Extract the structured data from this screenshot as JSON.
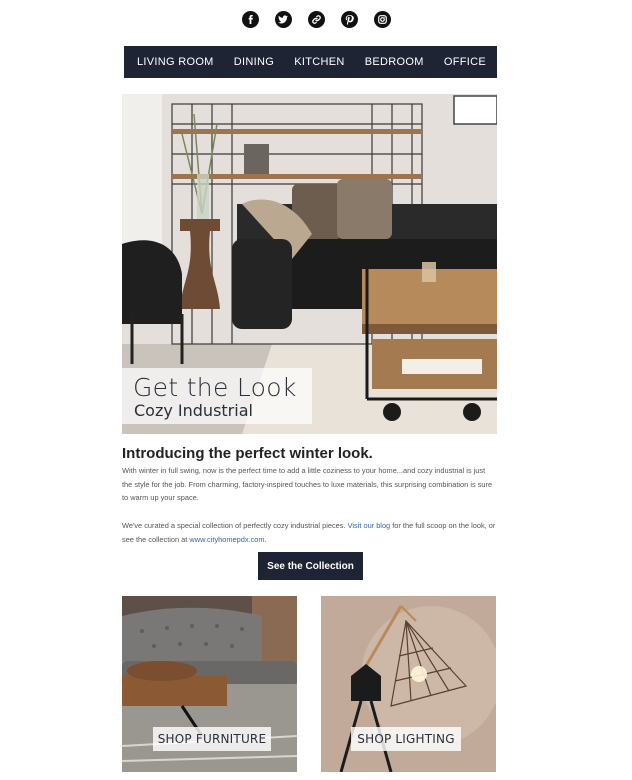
{
  "social": {
    "icons": [
      "facebook-icon",
      "twitter-icon",
      "link-icon",
      "pinterest-icon",
      "instagram-icon"
    ]
  },
  "nav": {
    "items": [
      "LIVING ROOM",
      "DINING",
      "KITCHEN",
      "BEDROOM",
      "OFFICE"
    ]
  },
  "hero": {
    "title": "Get the Look",
    "subtitle": "Cozy Industrial"
  },
  "article": {
    "headline": "Introducing the perfect winter look.",
    "paragraph1": "With winter in full swing, now is the perfect time to add a little coziness to your home...and cozy industrial is just the style for the job. From charming, factory-inspired touches to luxe materials, this surprising combination is sure to warm up your space.",
    "p2_before": "We've curated a special collection of perfectly cozy industrial pieces. ",
    "p2_link1": "Visit our blog",
    "p2_middle": " for the full scoop on the look, or see the collection at ",
    "p2_link2": "www.cityhomepdx.com",
    "p2_after": ".",
    "cta_label": "See the Collection"
  },
  "tiles": {
    "furniture_label": "SHOP FURNITURE",
    "lighting_label": "SHOP LIGHTING"
  },
  "colors": {
    "nav_bg": "#1e2433",
    "link": "#3366aa"
  }
}
